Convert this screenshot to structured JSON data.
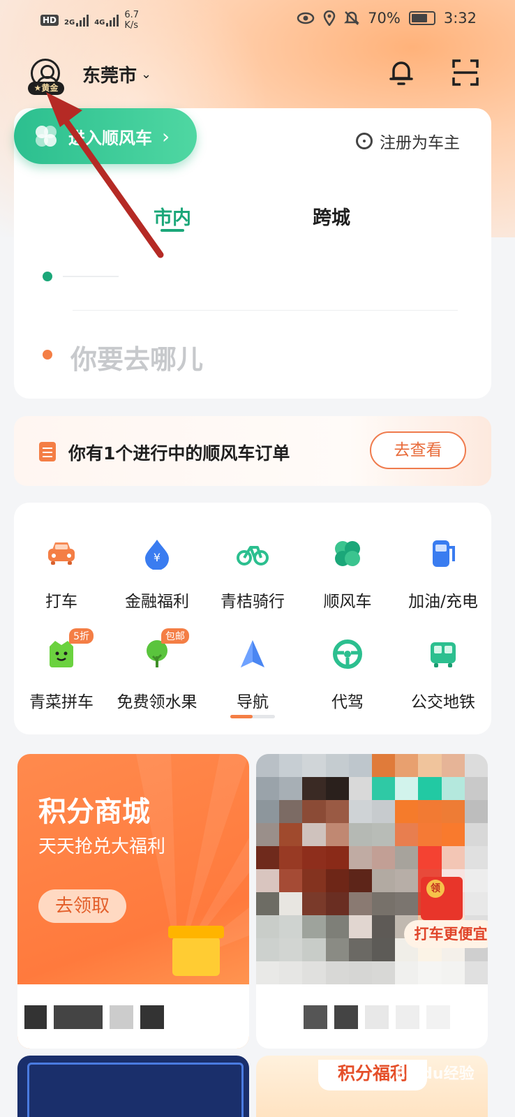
{
  "status_bar": {
    "network": "HD",
    "signal_1": "2G",
    "signal_2": "4G",
    "speed_value": "6.7",
    "speed_unit": "K/s",
    "battery": "70%",
    "time": "3:32"
  },
  "header": {
    "member_badge": "黄金",
    "city": "东莞市",
    "city_chevron": "⌄"
  },
  "main_card": {
    "shunfengche_button": "进入顺风车",
    "shunfengche_chevron": "›",
    "register_owner": "注册为车主",
    "tabs": [
      {
        "label": "市内",
        "active": true
      },
      {
        "label": "跨城",
        "active": false
      }
    ],
    "destination_placeholder": "你要去哪儿"
  },
  "order_banner": {
    "text": "你有1个进行中的顺风车订单",
    "button": "去查看"
  },
  "services": [
    {
      "label": "打车",
      "icon": "car-icon",
      "color": "#f47e45"
    },
    {
      "label": "金融福利",
      "icon": "yuan-drop-icon",
      "color": "#3a7cf0"
    },
    {
      "label": "青桔骑行",
      "icon": "bike-icon",
      "color": "#2cbf8f"
    },
    {
      "label": "顺风车",
      "icon": "leaf-icon",
      "color": "#1ba779"
    },
    {
      "label": "加油/充电",
      "icon": "fuel-pump-icon",
      "color": "#3a7cf0"
    },
    {
      "label": "青菜拼车",
      "icon": "veggie-icon",
      "color": "#5ac43d",
      "badge": "5折"
    },
    {
      "label": "免费领水果",
      "icon": "tree-icon",
      "color": "#5ac43d",
      "badge": "包邮"
    },
    {
      "label": "导航",
      "icon": "navigation-icon",
      "color": "#3a7cf0"
    },
    {
      "label": "代驾",
      "icon": "steering-wheel-icon",
      "color": "#2cbf8f"
    },
    {
      "label": "公交地铁",
      "icon": "bus-icon",
      "color": "#2cbf8f"
    }
  ],
  "promos": {
    "left_title": "积分商城",
    "left_subtitle": "天天抢兑大福利",
    "left_button": "去领取",
    "right_tag": "打车更便宜",
    "envelope_text": "领",
    "bottom_right_title": "积分福利"
  },
  "watermark": "Baidu经验",
  "colors": {
    "brand_green": "#1ba779",
    "accent_orange": "#f47e45",
    "annotation_arrow": "#b52a25"
  }
}
